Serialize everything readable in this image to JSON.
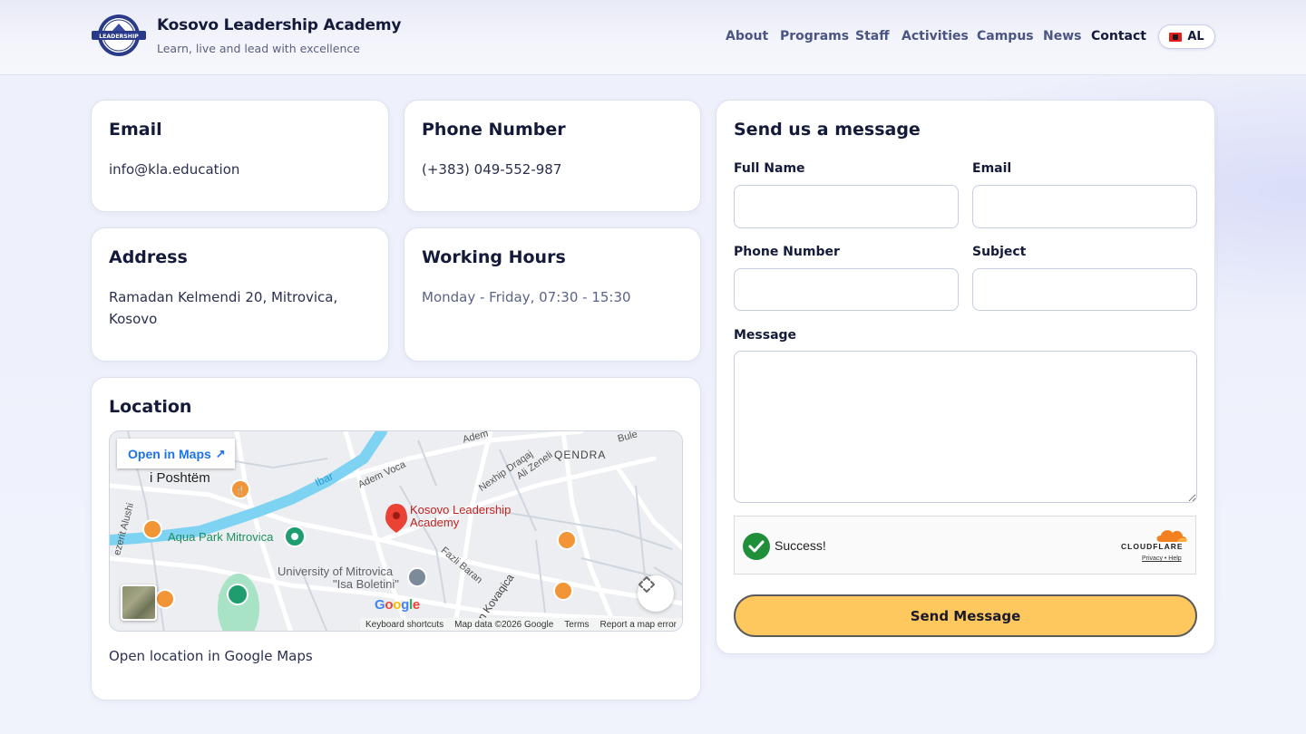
{
  "header": {
    "title": "Kosovo Leadership Academy",
    "subtitle": "Learn, live and lead with excellence",
    "logo_text": "LEADERSHIP",
    "nav": [
      {
        "label": "About"
      },
      {
        "label": "Programs"
      },
      {
        "label": "Staff"
      },
      {
        "label": "Activities"
      },
      {
        "label": "Campus"
      },
      {
        "label": "News"
      },
      {
        "label": "Contact",
        "active": true
      }
    ],
    "language": "AL"
  },
  "contact": {
    "email": {
      "title": "Email",
      "value": "info@kla.education"
    },
    "phone": {
      "title": "Phone Number",
      "value": "(+383) 049-552-987"
    },
    "address": {
      "title": "Address",
      "line1": "Ramadan Kelmendi 20, Mitrovica,",
      "line2": "Kosovo"
    },
    "hours": {
      "title": "Working Hours",
      "value": "Monday - Friday, 07:30 - 15:30"
    }
  },
  "location": {
    "title": "Location",
    "open_in_maps": "Open in Maps",
    "link_text": "Open location in Google Maps",
    "map": {
      "pin_label_1": "Kosovo Leadership",
      "pin_label_2": "Academy",
      "place_aqua": "Aqua Park Mitrovica",
      "place_univ_1": "University of Mitrovica",
      "place_univ_2": "\"Isa Boletini\"",
      "district": "QENDRA",
      "area": "i Poshtëm",
      "river": "Ibar",
      "street_adem_voca": "Adem Voca",
      "street_nexhip": "Nexhip Draqaj",
      "street_ali": "Ali Zeneli",
      "street_fazli": "Fazli Baran",
      "street_kovacica": "n Kovaqica",
      "street_alushi": "ezerit Alushi",
      "street_adem": "Adem",
      "street_bule": "Bule",
      "google": "Google",
      "footer": [
        "Keyboard shortcuts",
        "Map data ©2026 Google",
        "Terms",
        "Report a map error"
      ]
    }
  },
  "form": {
    "title": "Send us a message",
    "full_name_label": "Full Name",
    "email_label": "Email",
    "phone_label": "Phone Number",
    "subject_label": "Subject",
    "message_label": "Message",
    "full_name_value": "",
    "email_value": "",
    "phone_value": "",
    "subject_value": "",
    "message_value": "",
    "captcha_status": "Success!",
    "captcha_brand": "CLOUDFLARE",
    "captcha_links": "Privacy • Help",
    "submit_label": "Send Message"
  },
  "colors": {
    "accent_button": "#ffc85f",
    "brand_text": "#141a3a",
    "nav_text": "#4a5585",
    "success_green": "#1f8f3a",
    "map_water": "#7ed3f2",
    "map_park": "#a7e3c4",
    "map_pin": "#ea4335",
    "map_poi_food": "#f29537"
  }
}
